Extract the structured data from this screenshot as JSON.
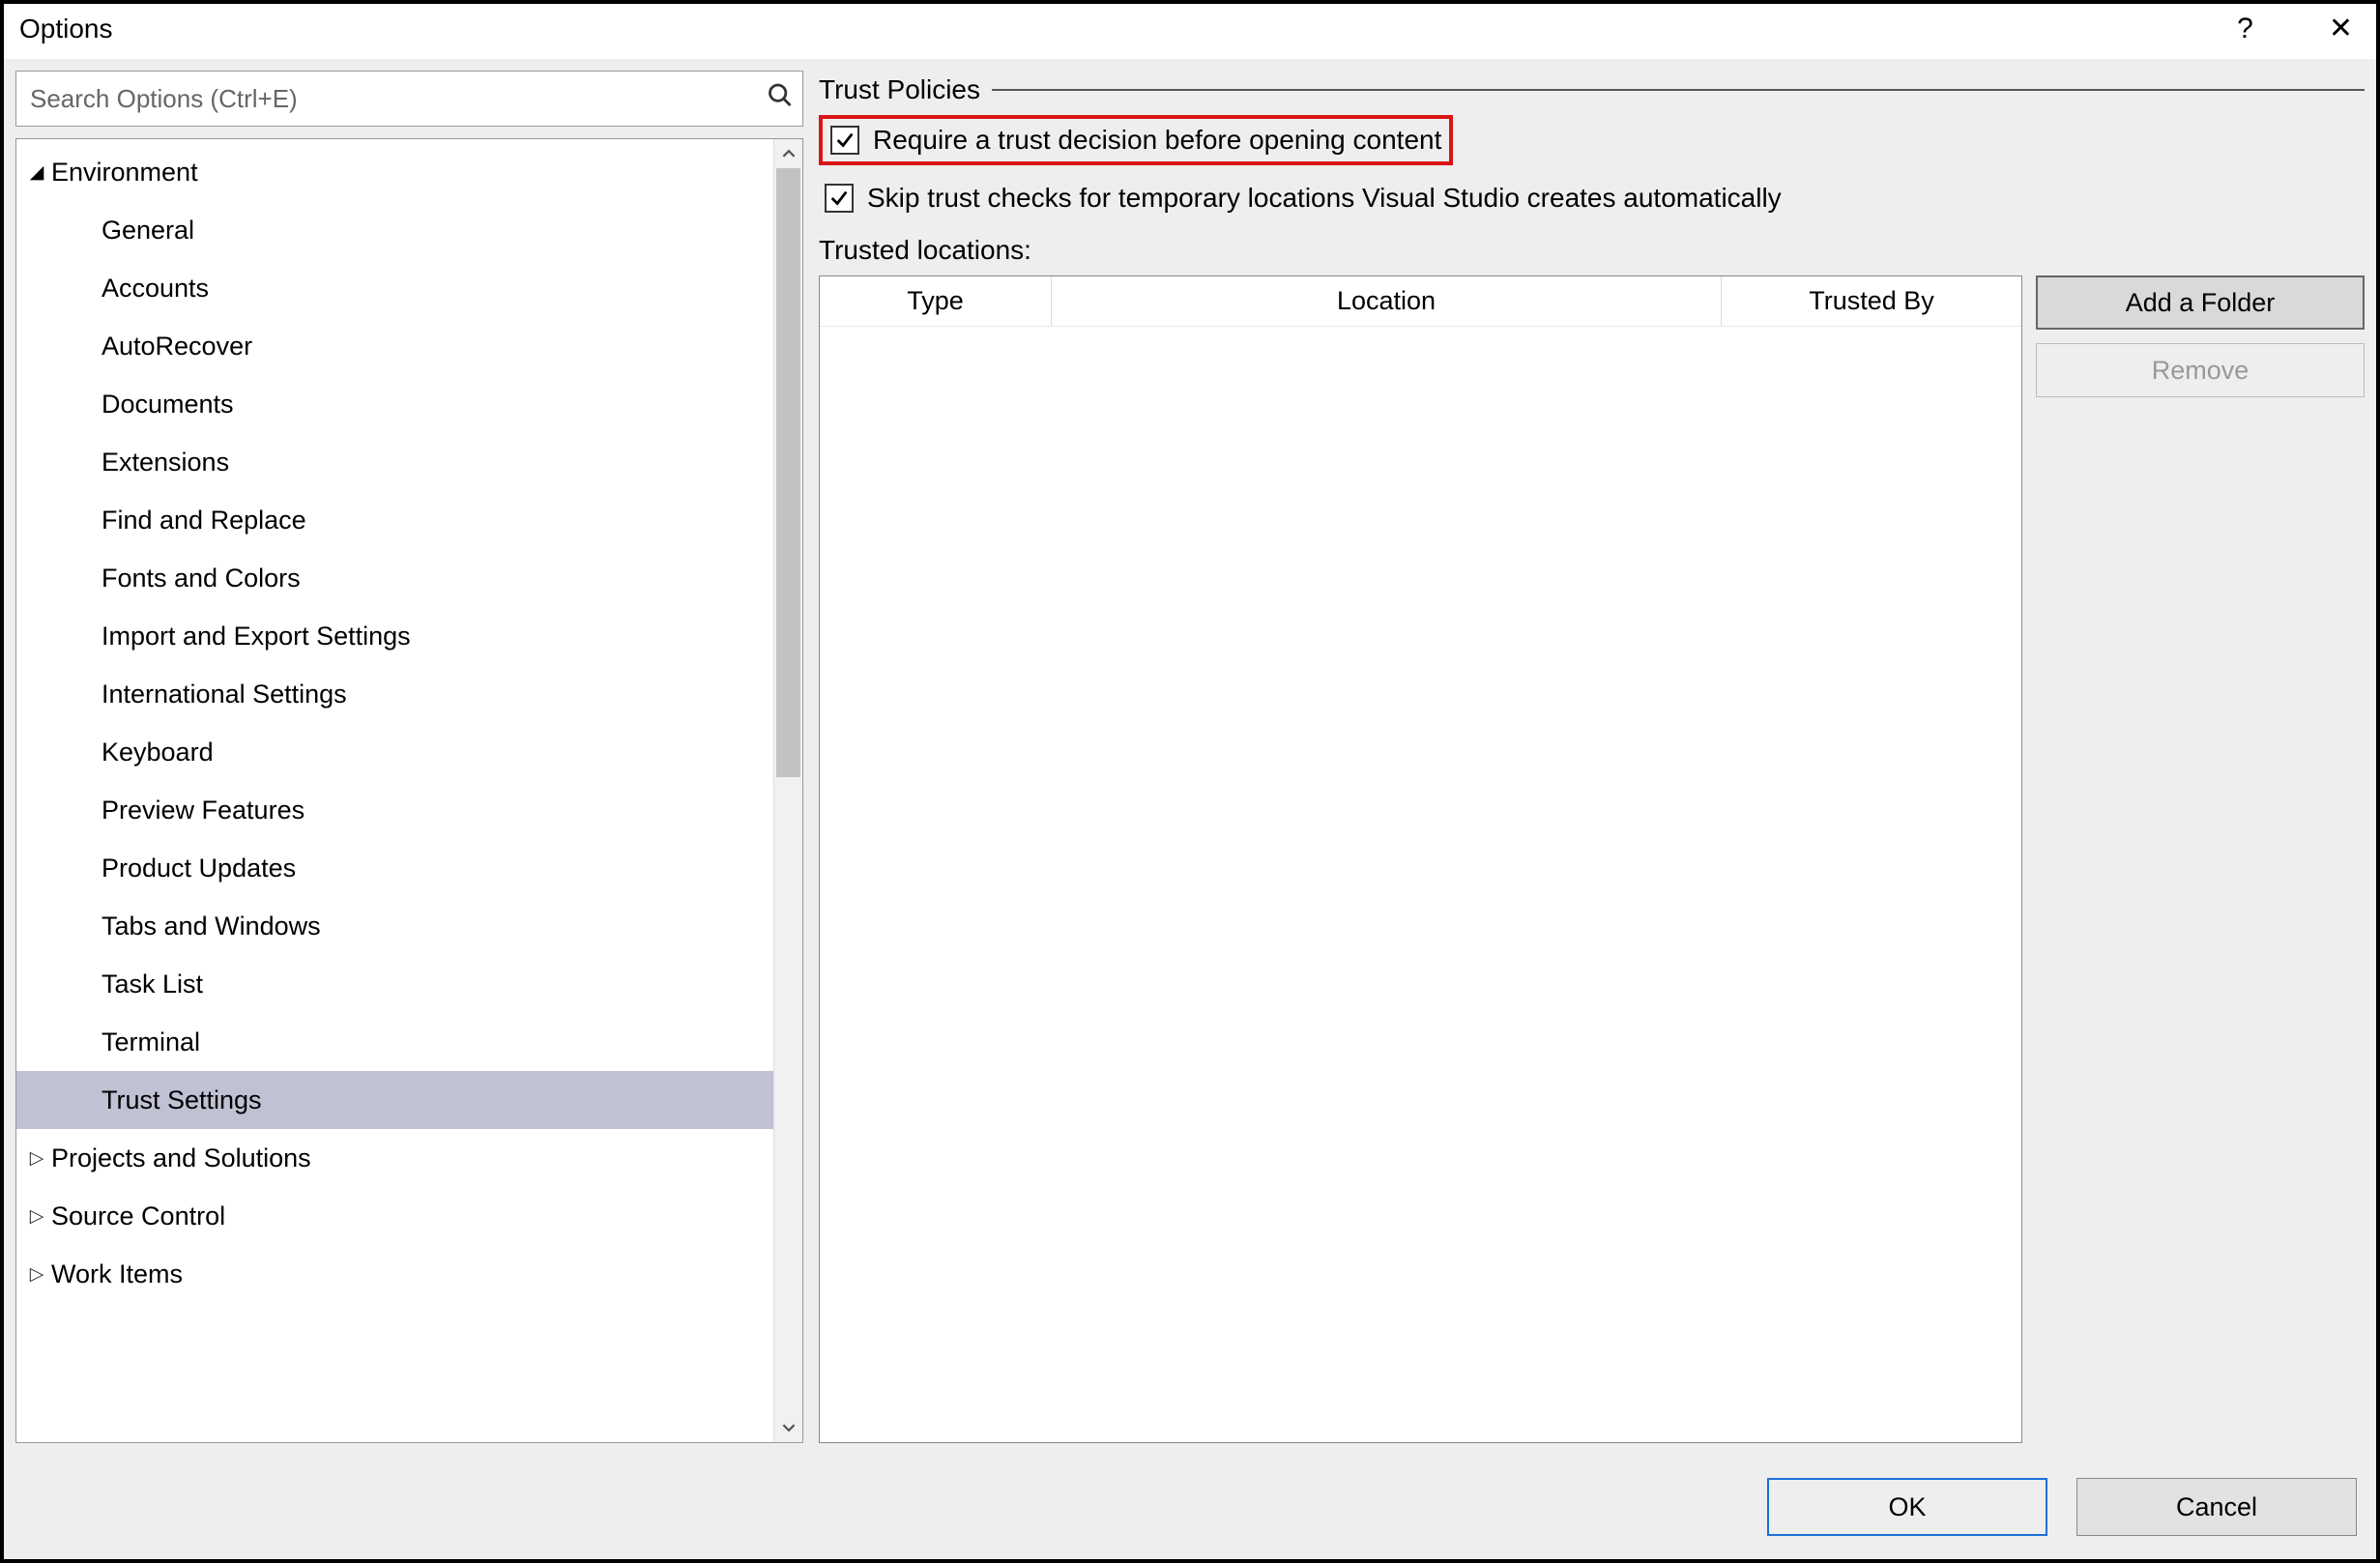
{
  "window": {
    "title": "Options",
    "help_glyph": "?",
    "close_glyph": "✕"
  },
  "search": {
    "placeholder": "Search Options (Ctrl+E)"
  },
  "tree": {
    "items": [
      {
        "label": "Environment",
        "level": 0,
        "expanded": true,
        "selected": false
      },
      {
        "label": "General",
        "level": 1,
        "expanded": null,
        "selected": false
      },
      {
        "label": "Accounts",
        "level": 1,
        "expanded": null,
        "selected": false
      },
      {
        "label": "AutoRecover",
        "level": 1,
        "expanded": null,
        "selected": false
      },
      {
        "label": "Documents",
        "level": 1,
        "expanded": null,
        "selected": false
      },
      {
        "label": "Extensions",
        "level": 1,
        "expanded": null,
        "selected": false
      },
      {
        "label": "Find and Replace",
        "level": 1,
        "expanded": null,
        "selected": false
      },
      {
        "label": "Fonts and Colors",
        "level": 1,
        "expanded": null,
        "selected": false
      },
      {
        "label": "Import and Export Settings",
        "level": 1,
        "expanded": null,
        "selected": false
      },
      {
        "label": "International Settings",
        "level": 1,
        "expanded": null,
        "selected": false
      },
      {
        "label": "Keyboard",
        "level": 1,
        "expanded": null,
        "selected": false
      },
      {
        "label": "Preview Features",
        "level": 1,
        "expanded": null,
        "selected": false
      },
      {
        "label": "Product Updates",
        "level": 1,
        "expanded": null,
        "selected": false
      },
      {
        "label": "Tabs and Windows",
        "level": 1,
        "expanded": null,
        "selected": false
      },
      {
        "label": "Task List",
        "level": 1,
        "expanded": null,
        "selected": false
      },
      {
        "label": "Terminal",
        "level": 1,
        "expanded": null,
        "selected": false
      },
      {
        "label": "Trust Settings",
        "level": 1,
        "expanded": null,
        "selected": true
      },
      {
        "label": "Projects and Solutions",
        "level": 0,
        "expanded": false,
        "selected": false
      },
      {
        "label": "Source Control",
        "level": 0,
        "expanded": false,
        "selected": false
      },
      {
        "label": "Work Items",
        "level": 0,
        "expanded": false,
        "selected": false
      }
    ]
  },
  "panel": {
    "group_title": "Trust Policies",
    "check1": {
      "checked": true,
      "label": "Require a trust decision before opening content",
      "highlight": true
    },
    "check2": {
      "checked": true,
      "label": "Skip trust checks for temporary locations Visual Studio creates automatically"
    },
    "locations_label": "Trusted locations:",
    "columns": {
      "type": "Type",
      "location": "Location",
      "trusted_by": "Trusted By"
    },
    "rows": [],
    "add_button": "Add a Folder",
    "remove_button": "Remove"
  },
  "footer": {
    "ok": "OK",
    "cancel": "Cancel"
  }
}
